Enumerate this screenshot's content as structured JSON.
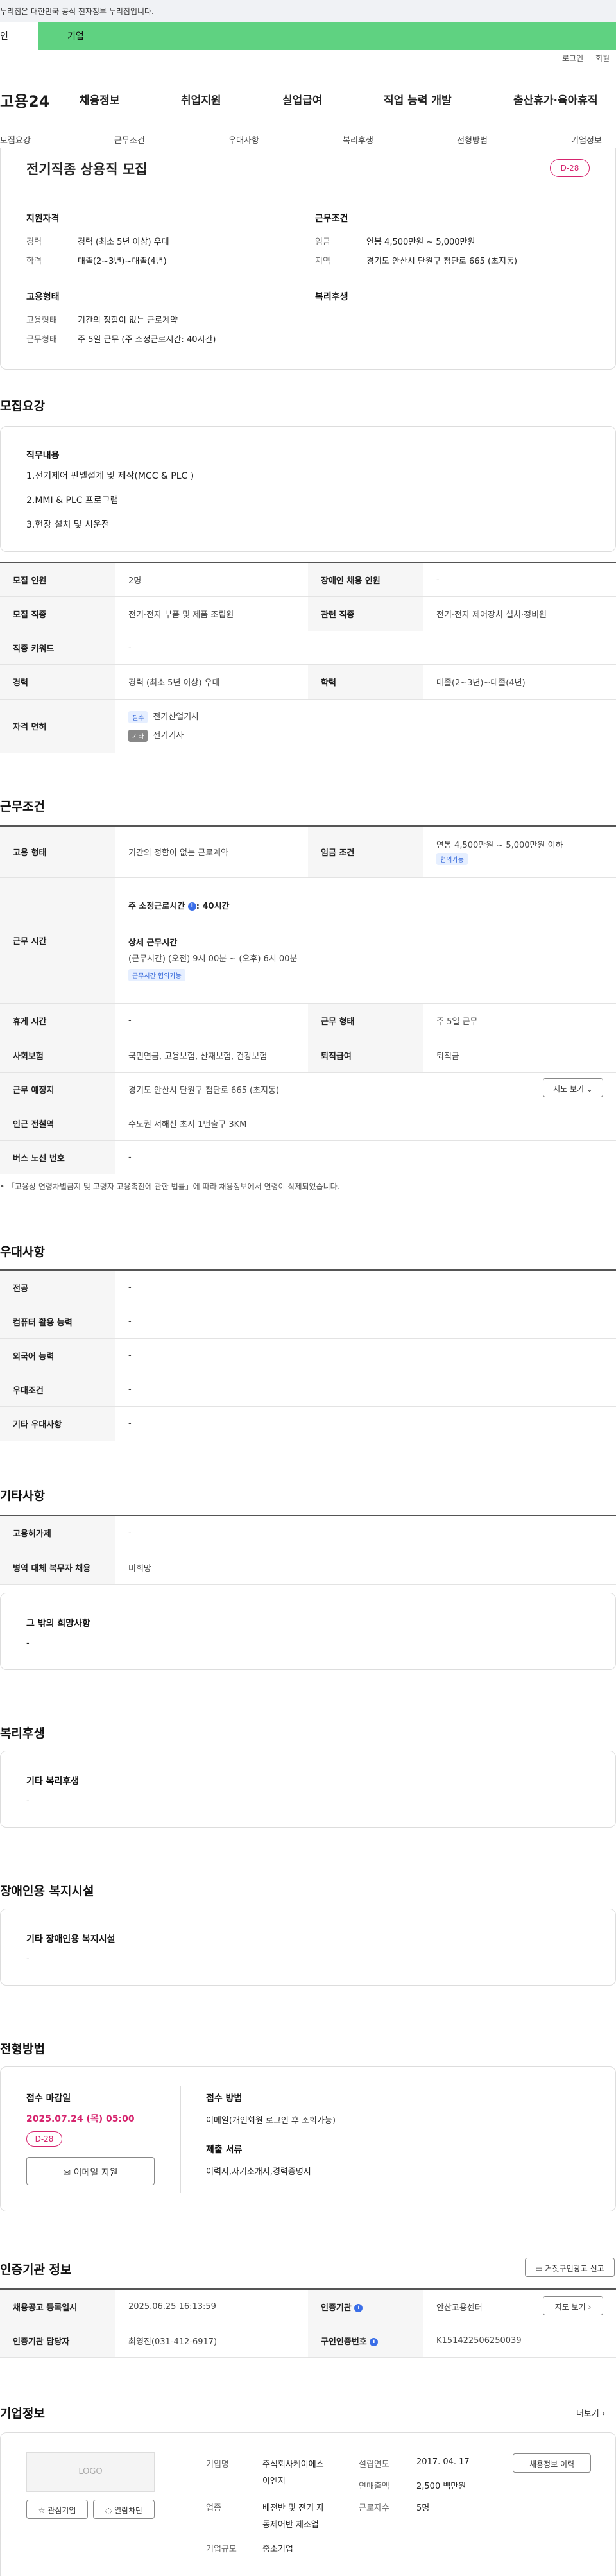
{
  "gov_notice": "누리집은 대한민국 공식 전자정부 누리집입니다.",
  "tabs": {
    "person": "인",
    "corp": "기업"
  },
  "util": {
    "login": "로그인",
    "join": "회원"
  },
  "gnb": {
    "logo": "고용24",
    "items": [
      "채용정보",
      "취업지원",
      "실업급여",
      "직업 능력 개발",
      "출산휴가·육아휴직"
    ]
  },
  "subnav": [
    "모집요강",
    "근무조건",
    "우대사항",
    "복리후생",
    "전형방법",
    "기업정보"
  ],
  "summary": {
    "title": "전기직종 상용직 모집",
    "dday": "D-28",
    "qual_title": "지원자격",
    "career_label": "경력",
    "career_value": "경력 (최소 5년 이상) 우대",
    "edu_label": "학력",
    "edu_value": "대졸(2~3년)~대졸(4년)",
    "cond_title": "근무조건",
    "wage_label": "임금",
    "wage_value": "연봉 4,500만원 ~ 5,000만원",
    "region_label": "지역",
    "region_value": "경기도 안산시 단원구 첨단로 665 (초지동)",
    "emp_title": "고용형태",
    "emptype_label": "고용형태",
    "emptype_value": "기간의 정함이 없는 근로계약",
    "worktype_label": "근무형태",
    "worktype_value": "주 5일 근무 (주 소정근로시간: 40시간)",
    "welfare_title": "복리후생"
  },
  "recruit": {
    "heading": "모집요강",
    "duty_title": "직무내용",
    "duties": [
      "1.전기제어 판넬설계 및 제작(MCC & PLC )",
      "2.MMI & PLC 프로그램",
      "3.현장 설치 및 시운전"
    ],
    "table": {
      "headcount_label": "모집 인원",
      "headcount_value": "2명",
      "disabled_label": "장애인 채용 인원",
      "disabled_value": "-",
      "job_label": "모집 직종",
      "job_value": "전기·전자 부품 및 제품 조립원",
      "related_label": "관련 직종",
      "related_value": "전기·전자 제어장치 설치·정비원",
      "keyword_label": "직종 키워드",
      "keyword_value": "-",
      "career_label": "경력",
      "career_value": "경력 (최소 5년 이상) 우대",
      "edu_label": "학력",
      "edu_value": "대졸(2~3년)~대졸(4년)",
      "license_label": "자격 면허",
      "license_req_tag": "필수",
      "license_req": "전기산업기사",
      "license_etc_tag": "기타",
      "license_etc": "전기기사"
    }
  },
  "work": {
    "heading": "근무조건",
    "emp_label": "고용 형태",
    "emp_value": "기간의 정함이 없는 근로계약",
    "wage_label": "임금 조건",
    "wage_value": "연봉 4,500만원 ~ 5,000만원 이하",
    "wage_chip": "협의가능",
    "hours_label": "근무 시간",
    "hours_main": "주 소정근로시간",
    "hours_main_value": ": 40시간",
    "hours_detail_title": "상세 근무시간",
    "hours_detail": "(근무시간) (오전) 9시 00분 ~ (오후) 6시 00분",
    "hours_chip": "근무시간 협의가능",
    "rest_label": "휴게 시간",
    "rest_value": "-",
    "form_label": "근무 형태",
    "form_value": "주 5일 근무",
    "insurance_label": "사회보험",
    "insurance_value": "국민연금, 고용보험, 산재보험, 건강보험",
    "retire_label": "퇴직급여",
    "retire_value": "퇴직금",
    "place_label": "근무 예정지",
    "place_value": "경기도 안산시 단원구 첨단로 665 (초지동)",
    "map_btn": "지도 보기",
    "station_label": "인근 전철역",
    "station_value": "수도권 서해선 초지 1번출구 3KM",
    "bus_label": "버스 노선 번호",
    "bus_value": "-",
    "footnote": "「고용상 연령차별금지 및 고령자 고용촉진에 관한 법률」에 따라 채용정보에서 연령이 삭제되었습니다."
  },
  "pref": {
    "heading": "우대사항",
    "rows": [
      {
        "label": "전공",
        "value": "-"
      },
      {
        "label": "컴퓨터 활용 능력",
        "value": "-"
      },
      {
        "label": "외국어 능력",
        "value": "-"
      },
      {
        "label": "우대조건",
        "value": "-"
      },
      {
        "label": "기타 우대사항",
        "value": "-"
      }
    ]
  },
  "etc": {
    "heading": "기타사항",
    "rows": [
      {
        "label": "고용허가제",
        "value": "-"
      },
      {
        "label": "병역 대체 복무자 채용",
        "value": "비희망"
      }
    ],
    "wish_title": "그 밖의 희망사항",
    "wish_value": "-"
  },
  "welfare": {
    "heading": "복리후생",
    "title": "기타 복리후생",
    "value": "-"
  },
  "disabled": {
    "heading": "장애인용 복지시설",
    "title": "기타 장애인용 복지시설",
    "value": "-"
  },
  "selection": {
    "heading": "전형방법",
    "deadline_title": "접수 마감일",
    "deadline": "2025.07.24 (목) 05:00",
    "dday": "D-28",
    "apply_btn": "이메일 지원",
    "method_title": "접수 방법",
    "method_value": "이메일(개인회원 로그인 후 조회가능)",
    "docs_title": "제출 서류",
    "docs_value": "이력서,자기소개서,경력증명서"
  },
  "cert": {
    "heading": "인증기관 정보",
    "report_btn": "거짓구인광고 신고",
    "reg_label": "채용공고 등록일시",
    "reg_value": "2025.06.25 16:13:59",
    "org_label": "인증기관",
    "org_value": "안산고용센터",
    "map_btn": "지도 보기",
    "manager_label": "인증기관 담당자",
    "manager_value": "최영진(031-412-6917)",
    "number_label": "구인인증번호",
    "number_value": "K151422506250039"
  },
  "company": {
    "heading": "기업정보",
    "more": "더보기",
    "logo_text": "LOGO",
    "fav_btn": "관심기업",
    "block_btn": "열람차단",
    "name_label": "기업명",
    "name_value_1": "주식회사케이에스",
    "name_value_2": "이엔지",
    "est_label": "설립연도",
    "est_value": "2017. 04. 17",
    "sales_label": "연매출액",
    "sales_value": "2,500 백만원",
    "industry_label": "업종",
    "industry_value_1": "배전반 및 전기 자",
    "industry_value_2": "동제어반 제조업",
    "staff_label": "근로자수",
    "staff_value": "5명",
    "size_label": "기업규모",
    "size_value": "중소기업",
    "jobs_btn": "채용정보 이력"
  }
}
